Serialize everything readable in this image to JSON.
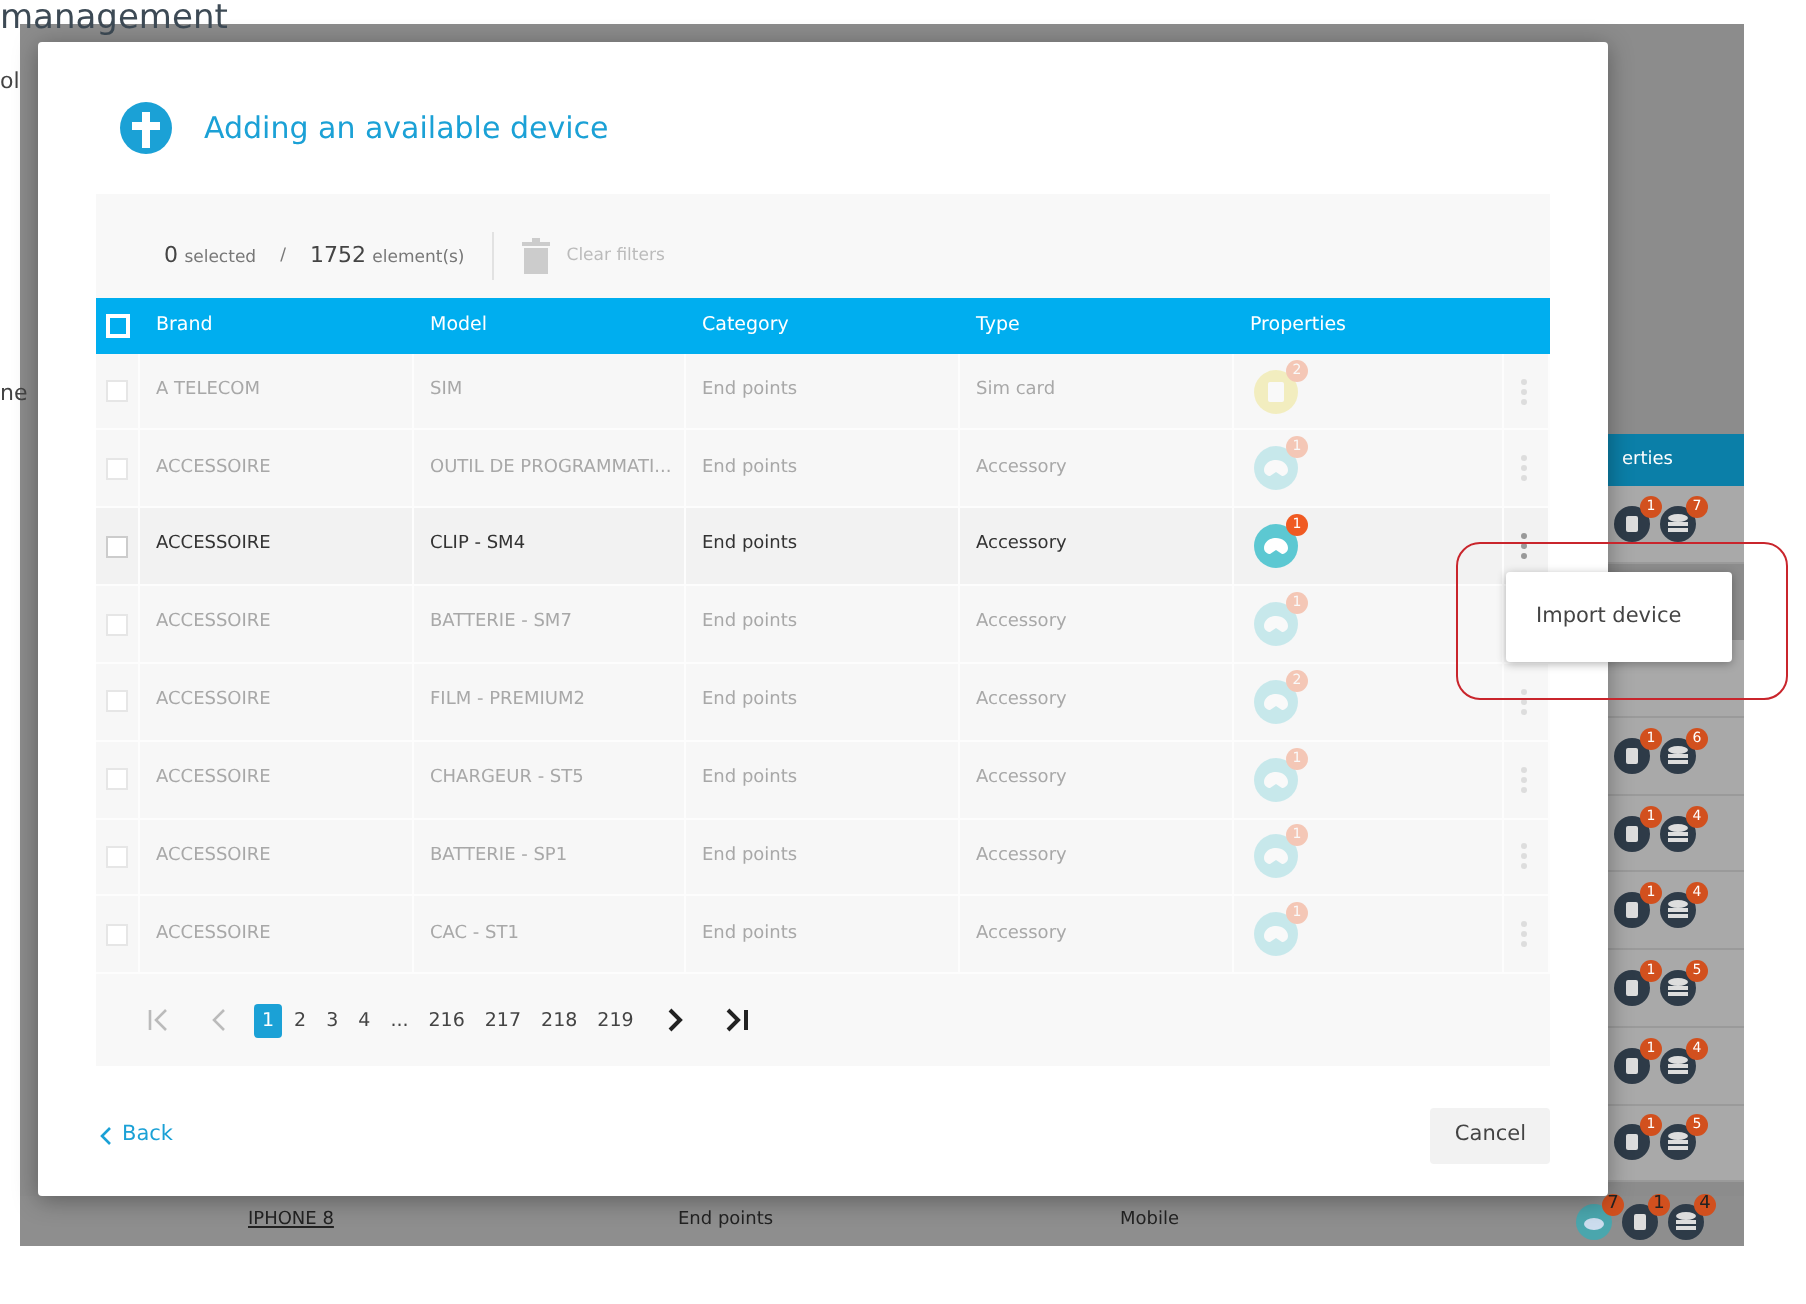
{
  "background_page": {
    "title": "management",
    "fragments": [
      "ol",
      "ne"
    ],
    "properties_header": "erties",
    "rows": [
      {
        "covered": false,
        "counts": [
          "1",
          "7"
        ]
      },
      {
        "covered": true
      },
      {
        "covered": false,
        "counts": [
          "1",
          "6"
        ]
      },
      {
        "covered": false,
        "counts": [
          "1",
          "4"
        ]
      },
      {
        "covered": false,
        "counts": [
          "1",
          "4"
        ]
      },
      {
        "covered": false,
        "counts": [
          "1",
          "5"
        ]
      },
      {
        "covered": false,
        "counts": [
          "1",
          "4"
        ]
      },
      {
        "covered": false,
        "counts": [
          "1",
          "5"
        ]
      }
    ],
    "last_row": {
      "model": "IPHONE 8",
      "category": "End points",
      "type": "Mobile",
      "counts": [
        "7",
        "1",
        "4"
      ]
    }
  },
  "modal": {
    "title": "Adding an available device",
    "toolbar": {
      "selected_count": "0",
      "selected_label": "selected",
      "separator": "/",
      "total_count": "1752",
      "total_label": "element(s)",
      "clear_filters": {
        "label": "Clear filters",
        "disabled": true
      }
    },
    "table": {
      "header_checkbox_checked": false,
      "columns": [
        "Brand",
        "Model",
        "Category",
        "Type",
        "Properties"
      ],
      "rows": [
        {
          "brand": "A TELECOM",
          "model": "SIM",
          "category": "End points",
          "type": "Sim card",
          "properties": [
            {
              "kind": "sim",
              "count": "2"
            }
          ],
          "disabled": true,
          "checked": false
        },
        {
          "brand": "ACCESSOIRE",
          "model": "OUTIL DE PROGRAMMATI...",
          "category": "End points",
          "type": "Accessory",
          "properties": [
            {
              "kind": "accessory",
              "count": "1"
            }
          ],
          "disabled": true,
          "checked": false
        },
        {
          "brand": "ACCESSOIRE",
          "model": "CLIP - SM4",
          "category": "End points",
          "type": "Accessory",
          "properties": [
            {
              "kind": "accessory",
              "count": "1"
            }
          ],
          "disabled": false,
          "checked": false
        },
        {
          "brand": "ACCESSOIRE",
          "model": "BATTERIE - SM7",
          "category": "End points",
          "type": "Accessory",
          "properties": [
            {
              "kind": "accessory",
              "count": "1"
            }
          ],
          "disabled": true,
          "checked": false
        },
        {
          "brand": "ACCESSOIRE",
          "model": "FILM - PREMIUM2",
          "category": "End points",
          "type": "Accessory",
          "properties": [
            {
              "kind": "accessory",
              "count": "2"
            }
          ],
          "disabled": true,
          "checked": false
        },
        {
          "brand": "ACCESSOIRE",
          "model": "CHARGEUR - ST5",
          "category": "End points",
          "type": "Accessory",
          "properties": [
            {
              "kind": "accessory",
              "count": "1"
            }
          ],
          "disabled": true,
          "checked": false
        },
        {
          "brand": "ACCESSOIRE",
          "model": "BATTERIE - SP1",
          "category": "End points",
          "type": "Accessory",
          "properties": [
            {
              "kind": "accessory",
              "count": "1"
            }
          ],
          "disabled": true,
          "checked": false
        },
        {
          "brand": "ACCESSOIRE",
          "model": "CAC - ST1",
          "category": "End points",
          "type": "Accessory",
          "properties": [
            {
              "kind": "accessory",
              "count": "1"
            }
          ],
          "disabled": true,
          "checked": false
        }
      ]
    },
    "pagination": [
      {
        "kind": "first",
        "disabled": true
      },
      {
        "kind": "prev",
        "disabled": true
      },
      {
        "kind": "page",
        "label": "1",
        "selected": true
      },
      {
        "kind": "page",
        "label": "2",
        "selected": false
      },
      {
        "kind": "page",
        "label": "3",
        "selected": false
      },
      {
        "kind": "page",
        "label": "4",
        "selected": false
      },
      {
        "kind": "ellipsis",
        "label": "..."
      },
      {
        "kind": "page",
        "label": "216",
        "selected": false
      },
      {
        "kind": "page",
        "label": "217",
        "selected": false
      },
      {
        "kind": "page",
        "label": "218",
        "selected": false
      },
      {
        "kind": "page",
        "label": "219",
        "selected": false
      },
      {
        "kind": "next",
        "disabled": false
      },
      {
        "kind": "last",
        "disabled": false
      }
    ],
    "back": "Back",
    "cancel": "Cancel"
  },
  "context_menu": {
    "items": [
      "Import device"
    ],
    "highlighted": true
  }
}
